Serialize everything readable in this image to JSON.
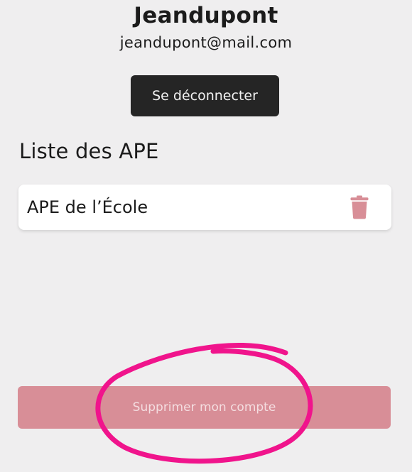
{
  "profile": {
    "username": "Jeandupont",
    "email": "jeandupont@mail.com",
    "logout_label": "Se déconnecter"
  },
  "ape_list": {
    "title": "Liste des APE",
    "items": [
      {
        "name": "APE de l’École"
      }
    ]
  },
  "delete_account_label": "Supprimer mon compte",
  "colors": {
    "background": "#efeeef",
    "logout_button": "#252525",
    "trash_icon": "#d88e97",
    "delete_button": "#d88e97",
    "delete_button_text": "#f4dde0",
    "annotation_circle": "#f0148c"
  },
  "icons": {
    "delete_ape": "trash-icon"
  }
}
